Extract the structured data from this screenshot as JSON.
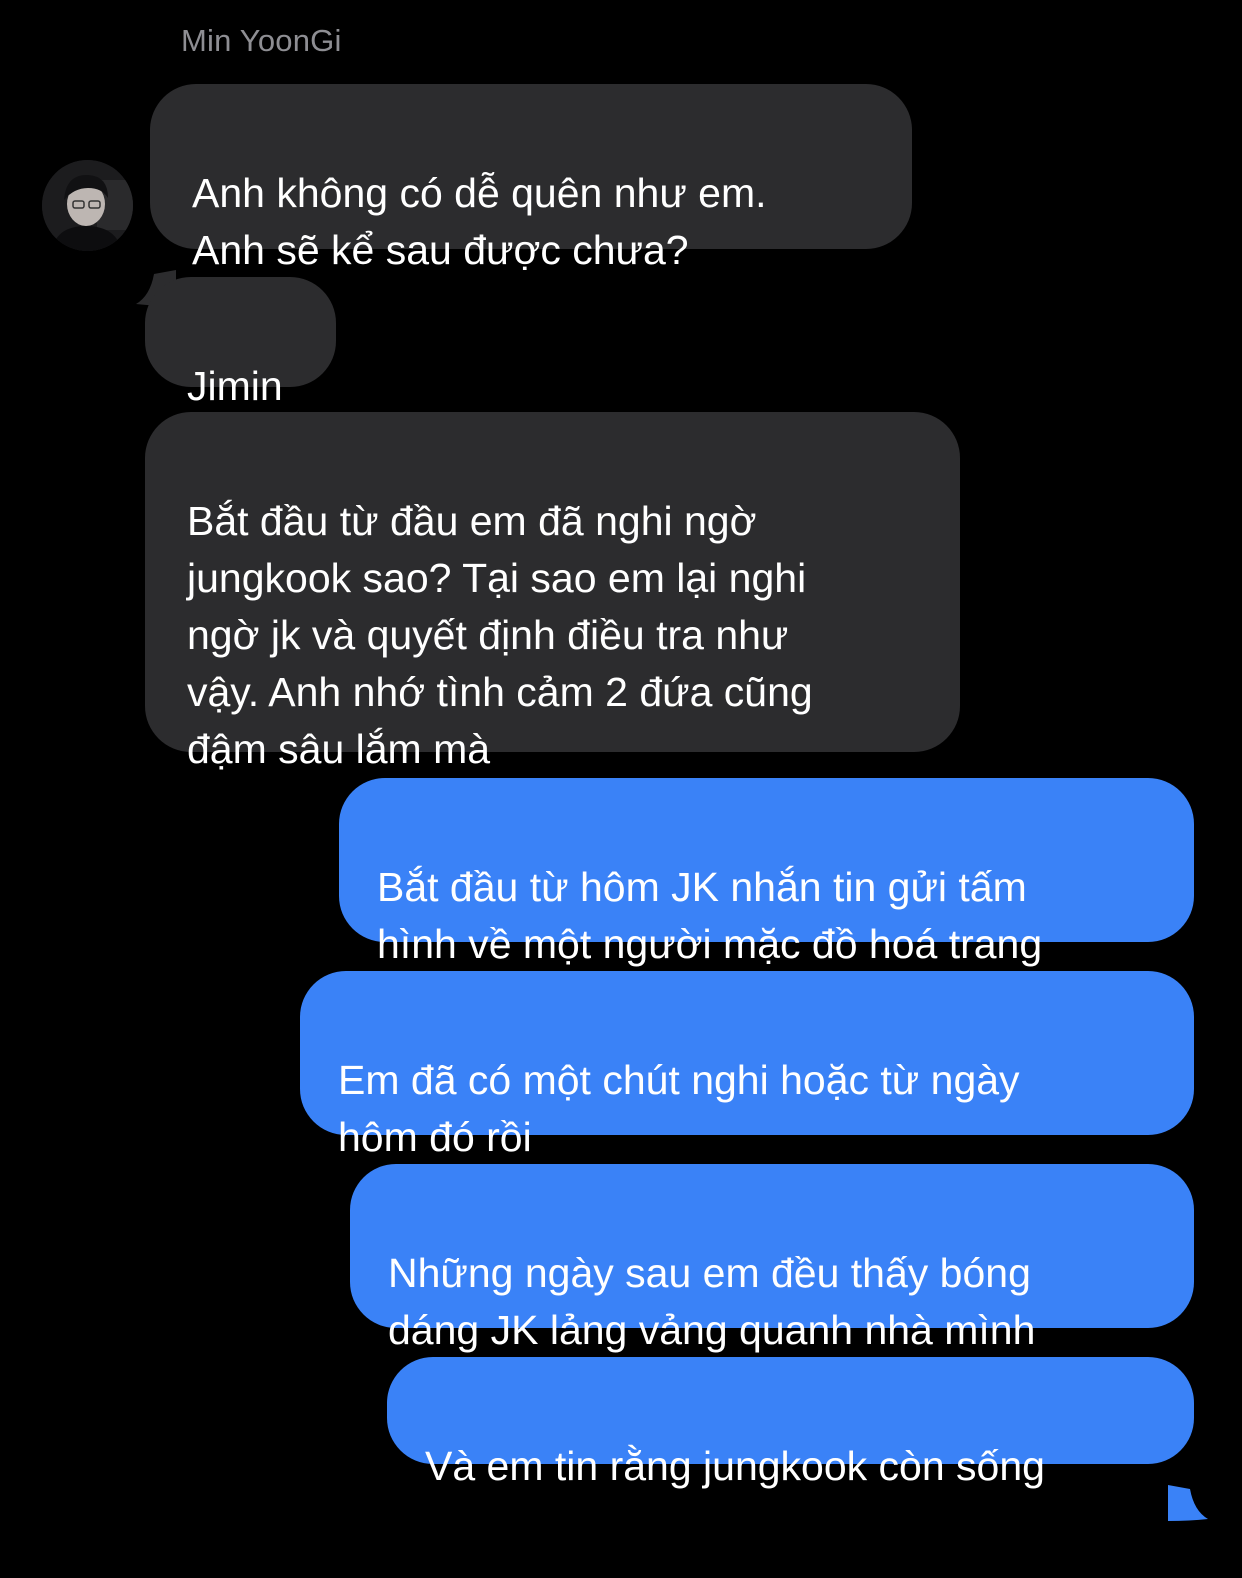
{
  "conversation": {
    "sender_name": "Min YoonGi",
    "incoming": [
      {
        "text": "Anh không có dễ quên như em.\nAnh sẽ kể sau được chưa?"
      },
      {
        "text": "Jimin"
      },
      {
        "text": "Bắt đầu từ đầu em đã nghi ngờ\njungkook sao? Tại sao em lại nghi\nngờ jk và quyết định điều tra như\nvậy. Anh nhớ tình cảm 2 đứa cũng\nđậm sâu lắm mà"
      }
    ],
    "outgoing": [
      {
        "text": "Bắt đầu từ hôm JK nhắn tin gửi tấm\nhình về một người mặc đồ hoá trang"
      },
      {
        "text": "Em đã có một chút nghi hoặc từ ngày\nhôm đó rồi"
      },
      {
        "text": "Những ngày sau em đều thấy bóng\ndáng JK lảng vảng quanh nhà mình"
      },
      {
        "text": "Và em tin rằng jungkook còn sống"
      }
    ]
  },
  "colors": {
    "background": "#000000",
    "incoming_bubble": "#2c2c2e",
    "outgoing_bubble": "#3a82f7",
    "sender_name": "#8e8e93",
    "text": "#ffffff"
  },
  "icons": {
    "avatar": "contact-avatar-photo"
  }
}
